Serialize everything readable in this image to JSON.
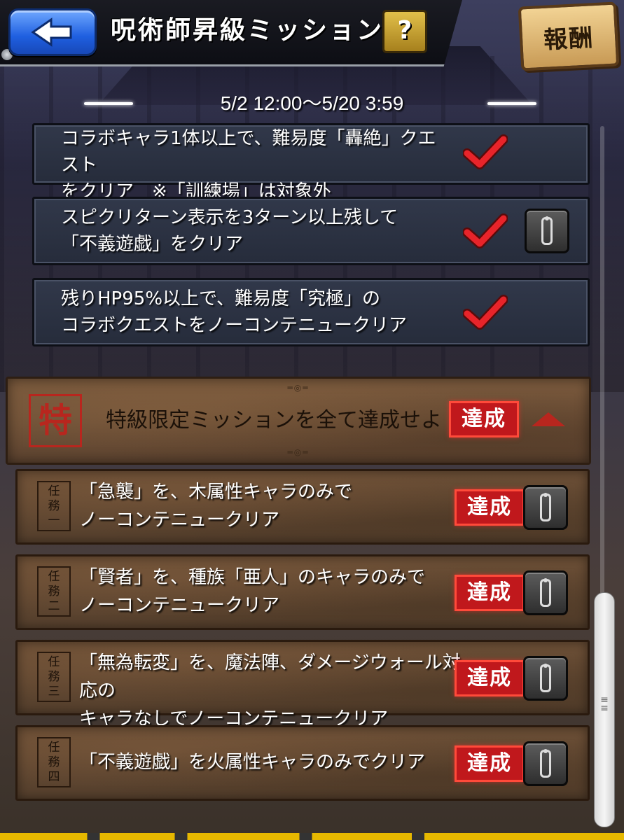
{
  "header": {
    "title": "呪術師昇級ミッション",
    "help_label": "?",
    "reward_label": "報酬"
  },
  "period": "5/2 12:00〜5/20 3:59",
  "missions": [
    {
      "line1": "コラボキャラ1体以上で、難易度「轟絶」クエスト",
      "line2": "をクリア　※「訓練場」は対象外",
      "cleared": true
    },
    {
      "line1": "スピクリターン表示を3ターン以上残して",
      "line2": "「不義遊戯」をクリア",
      "cleared": true
    },
    {
      "line1": "残りHP95%以上で、難易度「究極」の",
      "line2": "コラボクエストをノーコンテニュークリア",
      "cleared": true
    }
  ],
  "special": {
    "mark": "特",
    "text": "特級限定ミッションを全て達成せよ",
    "status": "達成"
  },
  "tasks": [
    {
      "seal": "任務一",
      "line1": "「急襲」を、木属性キャラのみで",
      "line2": "ノーコンテニュークリア",
      "status": "達成"
    },
    {
      "seal": "任務二",
      "line1": "「賢者」を、種族「亜人」のキャラのみで",
      "line2": "ノーコンテニュークリア",
      "status": "達成"
    },
    {
      "seal": "任務三",
      "line1": "「無為転変」を、魔法陣、ダメージウォール対応の",
      "line2": "キャラなしでノーコンテニュークリア",
      "status": "達成"
    },
    {
      "seal": "任務四",
      "line1": "「不義遊戯」を火属性キャラのみでクリア",
      "line2": "",
      "status": "達成"
    }
  ],
  "colors": {
    "back_button": "#1f5fe0",
    "check": "#e8242a",
    "stamp": "#c0181c",
    "card_dark": "#2b3242",
    "card_brown": "#5e4430"
  },
  "icons": {
    "back": "arrow-left-icon",
    "check": "checkmark-icon",
    "info": "info-icon",
    "collapse": "triangle-up-icon"
  }
}
